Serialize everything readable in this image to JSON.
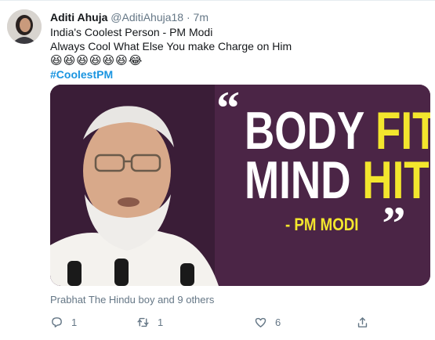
{
  "tweet": {
    "author_name": "Aditi Ahuja",
    "handle": "@AditiAhuja18",
    "separator": "·",
    "time": "7m",
    "text_line1": "India's Coolest Person - PM Modi",
    "text_line2": "Always Cool What Else You make Charge on Him",
    "emojis": "😆😆😆😆😆😆😂",
    "hashtag": "#CoolestPM"
  },
  "media": {
    "quote_open": "“",
    "line1_white": "BODY ",
    "line1_yellow": "FIT,",
    "line2_white": "MIND ",
    "line2_yellow": "HIT",
    "quote_close": "„",
    "attribution": "- PM MODI",
    "background_color": "#4b2546",
    "highlight_color": "#f3e62d"
  },
  "likers": "Prabhat The Hindu boy and 9 others",
  "actions": {
    "reply_count": "1",
    "retweet_count": "1",
    "like_count": "6"
  },
  "icons": {
    "reply": "reply-icon",
    "retweet": "retweet-icon",
    "like": "heart-icon",
    "share": "share-icon"
  }
}
